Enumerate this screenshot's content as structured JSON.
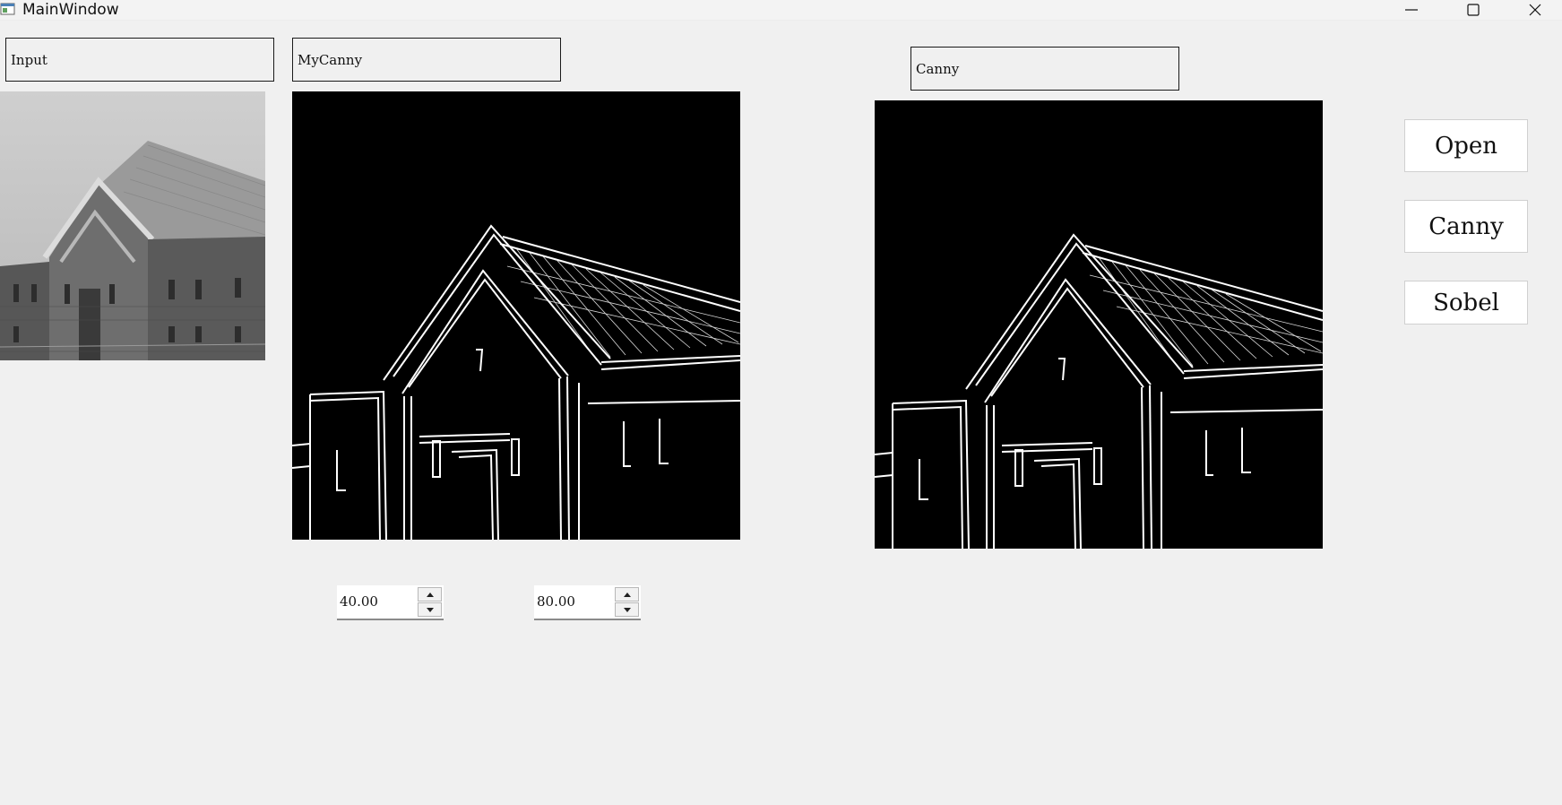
{
  "window": {
    "title": "MainWindow"
  },
  "labels": {
    "input": "Input",
    "mycanny": "MyCanny",
    "canny": "Canny"
  },
  "spinboxes": {
    "low_threshold": "40.00",
    "high_threshold": "80.00"
  },
  "buttons": {
    "open": "Open",
    "canny": "Canny",
    "sobel": "Sobel"
  },
  "images": {
    "input": "grayscale photo of a brick building",
    "mycanny": "edge map of building",
    "canny": "edge map of building"
  },
  "icons": {
    "app": "app-icon",
    "minimize": "minimize-icon",
    "maximize": "maximize-icon",
    "close": "close-icon",
    "spin_up": "arrow-up-icon",
    "spin_down": "arrow-down-icon"
  }
}
